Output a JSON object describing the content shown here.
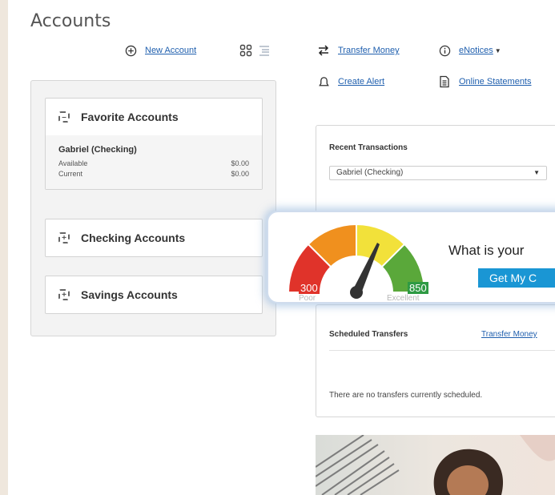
{
  "page": {
    "title": "Accounts"
  },
  "toolbar": {
    "new_account": "New Account",
    "transfer_money": "Transfer Money",
    "enotices": "eNotices",
    "create_alert": "Create Alert",
    "online_statements": "Online Statements"
  },
  "sidebar": {
    "favorites": {
      "title": "Favorite Accounts",
      "account": {
        "name": "Gabriel (Checking)",
        "rows": [
          {
            "label": "Available",
            "value": "$0.00"
          },
          {
            "label": "Current",
            "value": "$0.00"
          }
        ]
      }
    },
    "checking": {
      "title": "Checking Accounts"
    },
    "savings": {
      "title": "Savings Accounts"
    }
  },
  "recent": {
    "title": "Recent Transactions",
    "selected_account": "Gabriel (Checking)"
  },
  "credit": {
    "headline": "What is your",
    "button": "Get My C",
    "score_low": "300",
    "score_high": "850",
    "label_low": "Poor",
    "label_high": "Excellent",
    "colors": {
      "red": "#e0332a",
      "orange": "#f0901e",
      "yellow": "#f2e13a",
      "green": "#5aa83a",
      "accent": "#1a96d4"
    }
  },
  "scheduled": {
    "title": "Scheduled Transfers",
    "link": "Transfer Money",
    "empty": "There are no transfers currently scheduled."
  },
  "icons": [
    "plus-circle-icon",
    "grid-view-icon",
    "list-view-icon",
    "transfer-arrows-icon",
    "info-icon",
    "bell-icon",
    "document-icon",
    "collapse-icon",
    "expand-icon"
  ]
}
